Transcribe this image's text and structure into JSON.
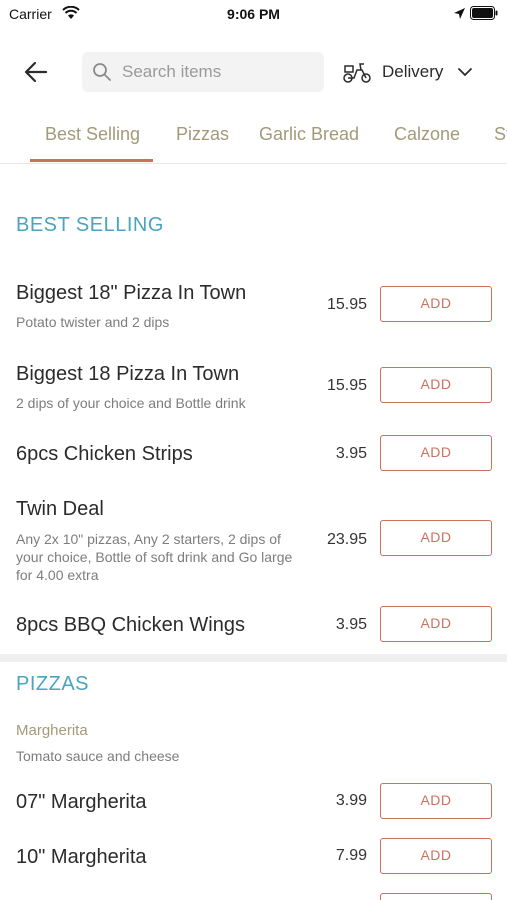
{
  "status": {
    "carrier": "Carrier",
    "time": "9:06 PM"
  },
  "header": {
    "search_placeholder": "Search items",
    "delivery_label": "Delivery"
  },
  "tabs": [
    {
      "label": "Best Selling",
      "active": true
    },
    {
      "label": "Pizzas",
      "active": false
    },
    {
      "label": "Garlic Bread",
      "active": false
    },
    {
      "label": "Calzone",
      "active": false
    },
    {
      "label": "St",
      "active": false
    }
  ],
  "sections": {
    "best_selling": {
      "title": "BEST SELLING",
      "items": [
        {
          "name": "Biggest 18\" Pizza In Town",
          "desc": "Potato twister and 2 dips",
          "price": "15.95",
          "add": "ADD"
        },
        {
          "name": "Biggest 18 Pizza In Town",
          "desc": "2 dips of your choice and Bottle drink",
          "price": "15.95",
          "add": "ADD"
        },
        {
          "name": "6pcs Chicken Strips",
          "desc": "",
          "price": "3.95",
          "add": "ADD"
        },
        {
          "name": "Twin Deal",
          "desc": "Any 2x 10\" pizzas, Any 2 starters, 2 dips of your choice, Bottle of soft drink and Go large for 4.00 extra",
          "price": "23.95",
          "add": "ADD"
        },
        {
          "name": "8pcs BBQ Chicken Wings",
          "desc": "",
          "price": "3.95",
          "add": "ADD"
        }
      ]
    },
    "pizzas": {
      "title": "PIZZAS",
      "subcategory": "Margherita",
      "subcategory_desc": "Tomato sauce and cheese",
      "items": [
        {
          "name": "07\" Margherita",
          "price": "3.99",
          "add": "ADD"
        },
        {
          "name": "10\" Margherita",
          "price": "7.99",
          "add": "ADD"
        }
      ]
    }
  },
  "colors": {
    "accent": "#c9735d",
    "section_title": "#4aa3c0",
    "tab_text": "#a39a78"
  }
}
